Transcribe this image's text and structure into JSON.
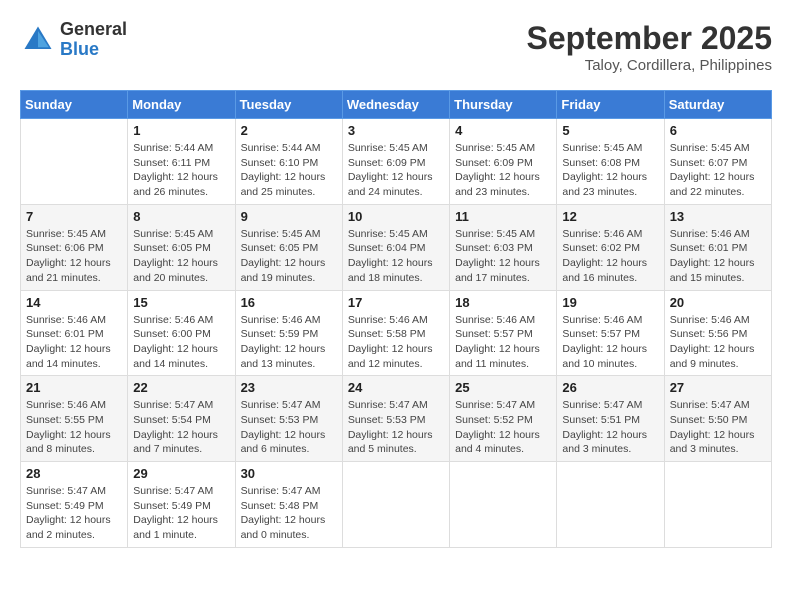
{
  "header": {
    "logo": {
      "general": "General",
      "blue": "Blue"
    },
    "month": "September 2025",
    "location": "Taloy, Cordillera, Philippines"
  },
  "days_of_week": [
    "Sunday",
    "Monday",
    "Tuesday",
    "Wednesday",
    "Thursday",
    "Friday",
    "Saturday"
  ],
  "weeks": [
    [
      {
        "day": "",
        "info": ""
      },
      {
        "day": "1",
        "info": "Sunrise: 5:44 AM\nSunset: 6:11 PM\nDaylight: 12 hours\nand 26 minutes."
      },
      {
        "day": "2",
        "info": "Sunrise: 5:44 AM\nSunset: 6:10 PM\nDaylight: 12 hours\nand 25 minutes."
      },
      {
        "day": "3",
        "info": "Sunrise: 5:45 AM\nSunset: 6:09 PM\nDaylight: 12 hours\nand 24 minutes."
      },
      {
        "day": "4",
        "info": "Sunrise: 5:45 AM\nSunset: 6:09 PM\nDaylight: 12 hours\nand 23 minutes."
      },
      {
        "day": "5",
        "info": "Sunrise: 5:45 AM\nSunset: 6:08 PM\nDaylight: 12 hours\nand 23 minutes."
      },
      {
        "day": "6",
        "info": "Sunrise: 5:45 AM\nSunset: 6:07 PM\nDaylight: 12 hours\nand 22 minutes."
      }
    ],
    [
      {
        "day": "7",
        "info": "Sunrise: 5:45 AM\nSunset: 6:06 PM\nDaylight: 12 hours\nand 21 minutes."
      },
      {
        "day": "8",
        "info": "Sunrise: 5:45 AM\nSunset: 6:05 PM\nDaylight: 12 hours\nand 20 minutes."
      },
      {
        "day": "9",
        "info": "Sunrise: 5:45 AM\nSunset: 6:05 PM\nDaylight: 12 hours\nand 19 minutes."
      },
      {
        "day": "10",
        "info": "Sunrise: 5:45 AM\nSunset: 6:04 PM\nDaylight: 12 hours\nand 18 minutes."
      },
      {
        "day": "11",
        "info": "Sunrise: 5:45 AM\nSunset: 6:03 PM\nDaylight: 12 hours\nand 17 minutes."
      },
      {
        "day": "12",
        "info": "Sunrise: 5:46 AM\nSunset: 6:02 PM\nDaylight: 12 hours\nand 16 minutes."
      },
      {
        "day": "13",
        "info": "Sunrise: 5:46 AM\nSunset: 6:01 PM\nDaylight: 12 hours\nand 15 minutes."
      }
    ],
    [
      {
        "day": "14",
        "info": "Sunrise: 5:46 AM\nSunset: 6:01 PM\nDaylight: 12 hours\nand 14 minutes."
      },
      {
        "day": "15",
        "info": "Sunrise: 5:46 AM\nSunset: 6:00 PM\nDaylight: 12 hours\nand 14 minutes."
      },
      {
        "day": "16",
        "info": "Sunrise: 5:46 AM\nSunset: 5:59 PM\nDaylight: 12 hours\nand 13 minutes."
      },
      {
        "day": "17",
        "info": "Sunrise: 5:46 AM\nSunset: 5:58 PM\nDaylight: 12 hours\nand 12 minutes."
      },
      {
        "day": "18",
        "info": "Sunrise: 5:46 AM\nSunset: 5:57 PM\nDaylight: 12 hours\nand 11 minutes."
      },
      {
        "day": "19",
        "info": "Sunrise: 5:46 AM\nSunset: 5:57 PM\nDaylight: 12 hours\nand 10 minutes."
      },
      {
        "day": "20",
        "info": "Sunrise: 5:46 AM\nSunset: 5:56 PM\nDaylight: 12 hours\nand 9 minutes."
      }
    ],
    [
      {
        "day": "21",
        "info": "Sunrise: 5:46 AM\nSunset: 5:55 PM\nDaylight: 12 hours\nand 8 minutes."
      },
      {
        "day": "22",
        "info": "Sunrise: 5:47 AM\nSunset: 5:54 PM\nDaylight: 12 hours\nand 7 minutes."
      },
      {
        "day": "23",
        "info": "Sunrise: 5:47 AM\nSunset: 5:53 PM\nDaylight: 12 hours\nand 6 minutes."
      },
      {
        "day": "24",
        "info": "Sunrise: 5:47 AM\nSunset: 5:53 PM\nDaylight: 12 hours\nand 5 minutes."
      },
      {
        "day": "25",
        "info": "Sunrise: 5:47 AM\nSunset: 5:52 PM\nDaylight: 12 hours\nand 4 minutes."
      },
      {
        "day": "26",
        "info": "Sunrise: 5:47 AM\nSunset: 5:51 PM\nDaylight: 12 hours\nand 3 minutes."
      },
      {
        "day": "27",
        "info": "Sunrise: 5:47 AM\nSunset: 5:50 PM\nDaylight: 12 hours\nand 3 minutes."
      }
    ],
    [
      {
        "day": "28",
        "info": "Sunrise: 5:47 AM\nSunset: 5:49 PM\nDaylight: 12 hours\nand 2 minutes."
      },
      {
        "day": "29",
        "info": "Sunrise: 5:47 AM\nSunset: 5:49 PM\nDaylight: 12 hours\nand 1 minute."
      },
      {
        "day": "30",
        "info": "Sunrise: 5:47 AM\nSunset: 5:48 PM\nDaylight: 12 hours\nand 0 minutes."
      },
      {
        "day": "",
        "info": ""
      },
      {
        "day": "",
        "info": ""
      },
      {
        "day": "",
        "info": ""
      },
      {
        "day": "",
        "info": ""
      }
    ]
  ]
}
